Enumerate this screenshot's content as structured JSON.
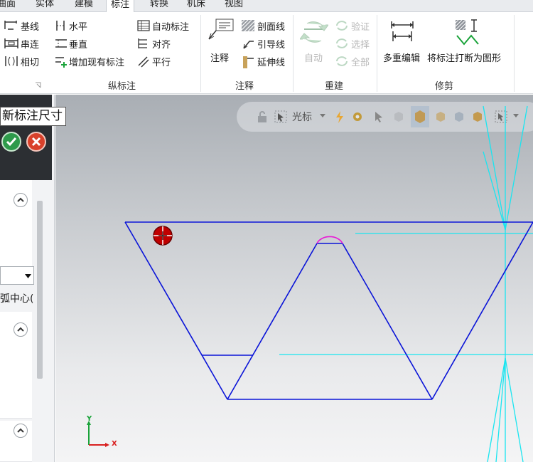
{
  "tabs": [
    "曲面",
    "实体",
    "建模",
    "标注",
    "转换",
    "机床",
    "视图"
  ],
  "active_tab": "标注",
  "ribbon": {
    "groups": [
      {
        "name": "纵标注",
        "tools": [
          "基线",
          "串连",
          "相切",
          "水平",
          "垂直",
          "增加现有标注",
          "自动标注",
          "对齐",
          "平行"
        ]
      },
      {
        "name": "注释",
        "tools": [
          "注释",
          "剖面线",
          "引导线",
          "延伸线"
        ]
      },
      {
        "name": "重建",
        "tools": [
          "自动",
          "验证",
          "选择",
          "全部"
        ]
      },
      {
        "name": "修剪",
        "tools": [
          "多重编辑",
          "将标注打断为图形"
        ]
      }
    ]
  },
  "panel": {
    "tooltip": "新标注尺寸",
    "select_value": "",
    "option_text": "弧中心("
  },
  "viewport_toolbar": {
    "cursor_label": "光标"
  },
  "axes": {
    "x": "X",
    "y": "Y"
  },
  "colors": {
    "geometry": "#0a14d8",
    "construction": "#19e5f0",
    "arc": "#e81ad6",
    "marker": "#c00000"
  }
}
